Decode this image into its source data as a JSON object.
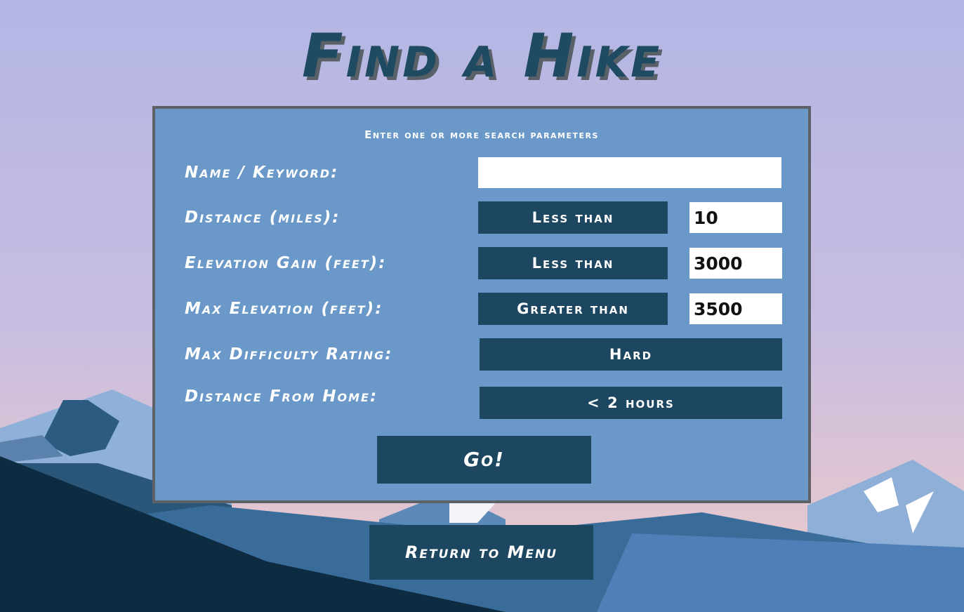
{
  "title": "Find a Hike",
  "form": {
    "subtitle": "Enter one or more search parameters",
    "rows": [
      {
        "label": "Name / Keyword:",
        "value": ""
      },
      {
        "label": "Distance (miles):",
        "comparator": "Less than",
        "value": "10"
      },
      {
        "label": "Elevation Gain (feet):",
        "comparator": "Less than",
        "value": "3000"
      },
      {
        "label": "Max Elevation (feet):",
        "comparator": "Greater than",
        "value": "3500"
      },
      {
        "label": "Max Difficulty Rating:",
        "selected": "Hard"
      },
      {
        "label": "Distance From Home:",
        "selected": "< 2 hours"
      }
    ],
    "go_label": "Go!"
  },
  "return_label": "Return to Menu",
  "colors": {
    "sky_top": "#b3b6e4",
    "sky_bottom": "#eccbd0",
    "panel": "#6a98c9",
    "panel_border": "#5e6166",
    "button": "#1d4760",
    "title": "#1e4a62"
  }
}
